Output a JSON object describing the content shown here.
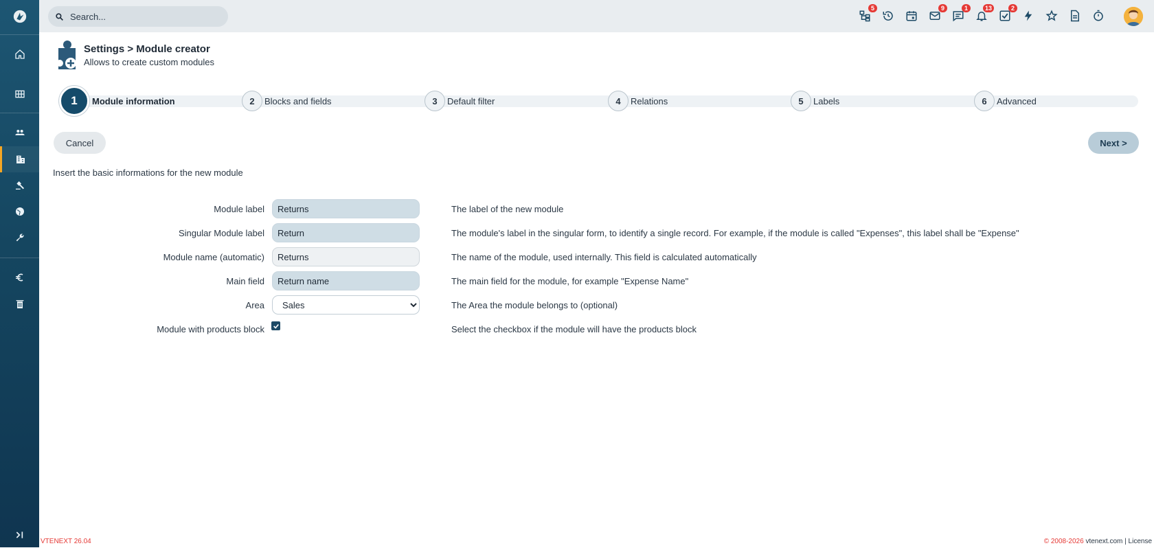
{
  "topbar": {
    "search_placeholder": "Search...",
    "icons": [
      {
        "name": "process-tree-icon",
        "badge": "5"
      },
      {
        "name": "history-icon",
        "badge": ""
      },
      {
        "name": "calendar-icon",
        "badge": ""
      },
      {
        "name": "mail-icon",
        "badge": "9"
      },
      {
        "name": "chat-icon",
        "badge": "1"
      },
      {
        "name": "bell-icon",
        "badge": "13"
      },
      {
        "name": "tasks-icon",
        "badge": "2"
      },
      {
        "name": "lightning-icon",
        "badge": ""
      },
      {
        "name": "star-icon",
        "badge": ""
      },
      {
        "name": "document-icon",
        "badge": ""
      },
      {
        "name": "timer-icon",
        "badge": ""
      }
    ]
  },
  "header": {
    "title": "Settings > Module creator",
    "subtitle": "Allows to create custom modules"
  },
  "stepper": [
    {
      "num": "1",
      "label": "Module information",
      "active": true
    },
    {
      "num": "2",
      "label": "Blocks and fields"
    },
    {
      "num": "3",
      "label": "Default filter"
    },
    {
      "num": "4",
      "label": "Relations"
    },
    {
      "num": "5",
      "label": "Labels"
    },
    {
      "num": "6",
      "label": "Advanced"
    }
  ],
  "buttons": {
    "cancel": "Cancel",
    "next": "Next >"
  },
  "intro": "Insert the basic informations for the new module",
  "form": {
    "module_label": {
      "label": "Module label",
      "value": "Returns",
      "desc": "The label of the new module"
    },
    "singular_label": {
      "label": "Singular Module label",
      "value": "Return",
      "desc": "The module's label in the singular form, to identify a single record. For example, if the module is called \"Expenses\", this label shall be \"Expense\""
    },
    "module_name": {
      "label": "Module name (automatic)",
      "value": "Returns",
      "desc": "The name of the module, used internally. This field is calculated automatically"
    },
    "main_field": {
      "label": "Main field",
      "value": "Return name",
      "desc": "The main field for the module, for example \"Expense Name\""
    },
    "area": {
      "label": "Area",
      "value": "Sales",
      "desc": "The Area the module belongs to (optional)"
    },
    "products_block": {
      "label": "Module with products block",
      "checked": true,
      "desc": "Select the checkbox if the module will have the products block"
    }
  },
  "footer": {
    "version": "VTENEXT 26.04",
    "copyright": "© 2008-2026",
    "site": "vtenext.com",
    "separator": "|",
    "license": "License"
  },
  "colors": {
    "sidebar": "#154660",
    "accent": "#f5a623",
    "badge": "#e53935",
    "step_active": "#154b6a"
  }
}
